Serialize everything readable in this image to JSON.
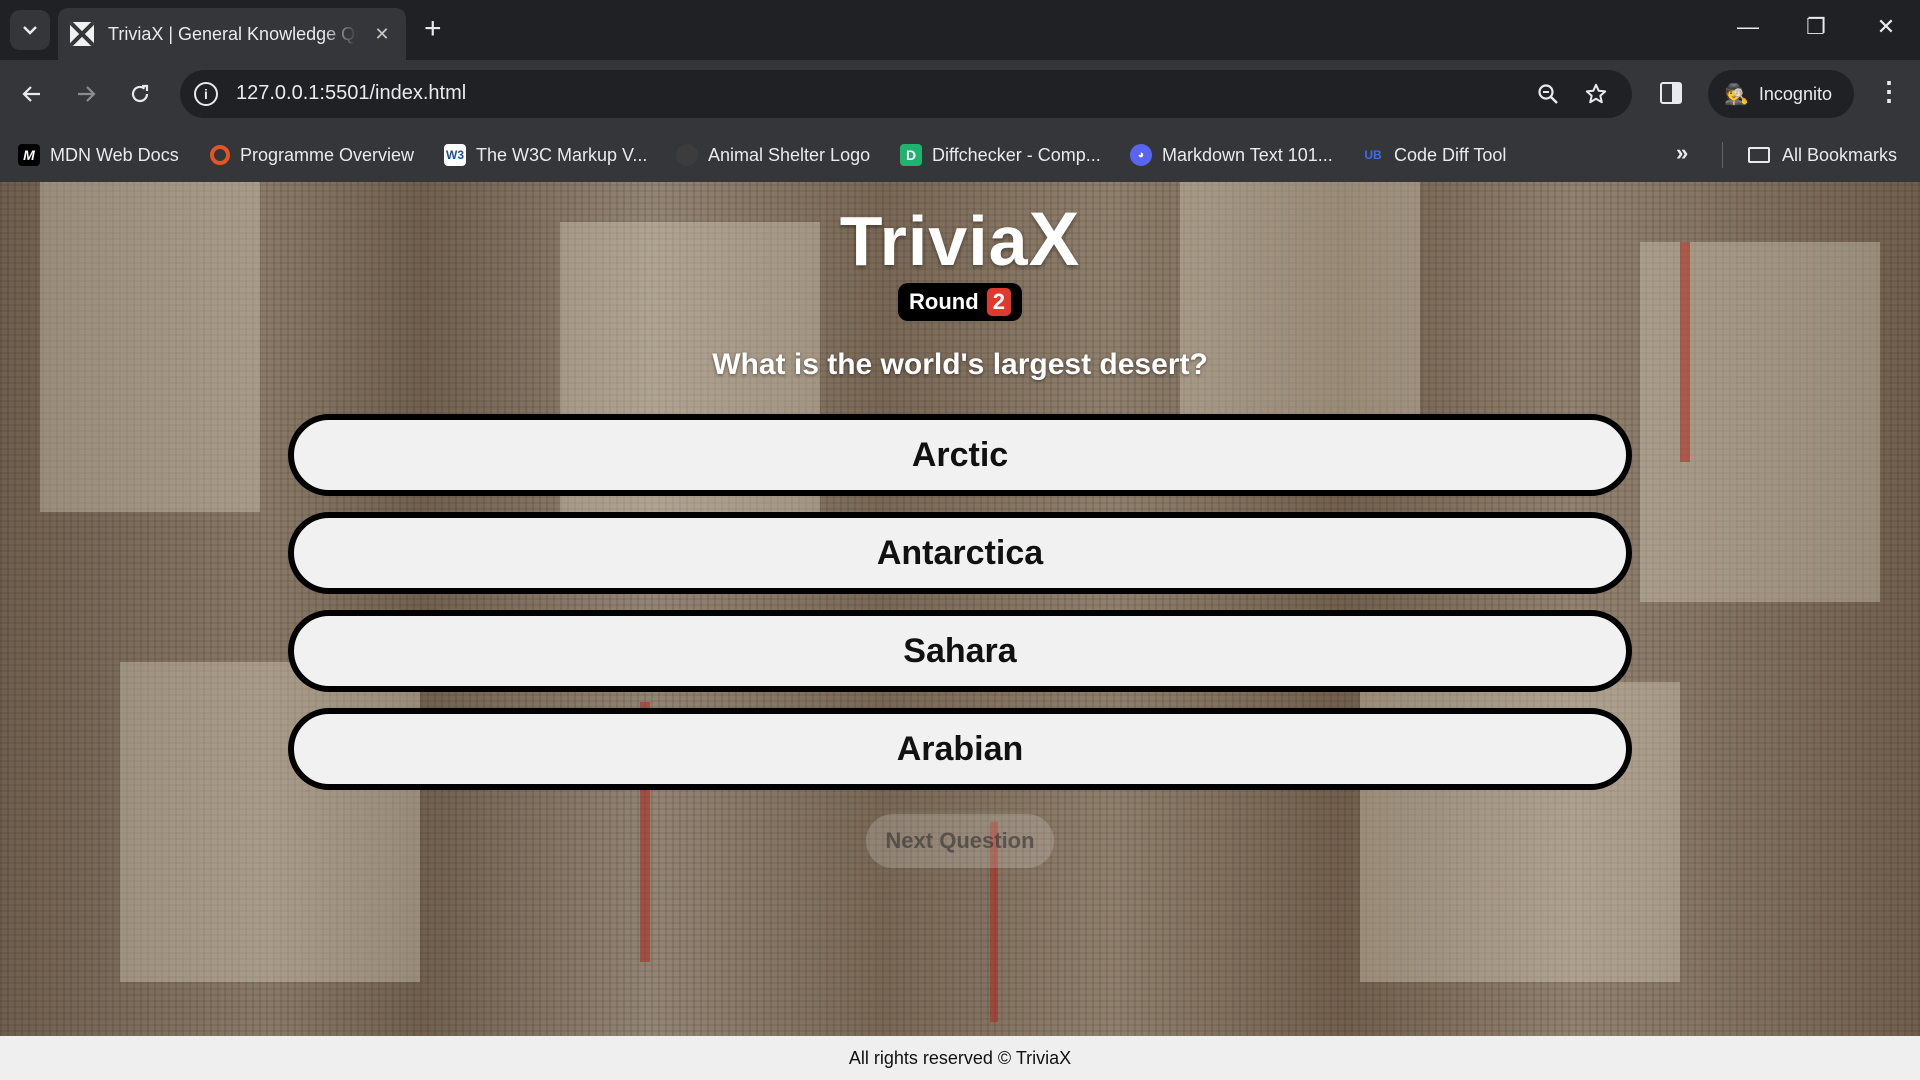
{
  "browser": {
    "tab_title": "TriviaX | General Knowledge Quiz",
    "new_tab_symbol": "+",
    "close_symbol": "✕",
    "url": "127.0.0.1:5501/index.html",
    "incognito_label": "Incognito",
    "window_controls": {
      "minimize": "—",
      "restore": "❐",
      "close": "✕"
    }
  },
  "bookmarks": {
    "items": [
      {
        "label": "MDN Web Docs",
        "icon": "mdn-icon",
        "icon_text": "M",
        "color": "#000000"
      },
      {
        "label": "Programme Overview",
        "icon": "ring-icon",
        "icon_text": "",
        "color": "#e8541f"
      },
      {
        "label": "The W3C Markup V...",
        "icon": "w3c-icon",
        "icon_text": "W3",
        "color": "#ffffff"
      },
      {
        "label": "Animal Shelter Logo",
        "icon": "github-icon",
        "icon_text": "",
        "color": "#3c3c3c"
      },
      {
        "label": "Diffchecker - Comp...",
        "icon": "diffchecker-icon",
        "icon_text": "D",
        "color": "#1fb46e"
      },
      {
        "label": "Markdown Text 101...",
        "icon": "discord-icon",
        "icon_text": "",
        "color": "#5865f2"
      },
      {
        "label": "Code Diff Tool",
        "icon": "code-diff-icon",
        "icon_text": "UB",
        "color": "#3b6ee8"
      }
    ],
    "all_bookmarks_label": "All Bookmarks"
  },
  "page": {
    "logo_text": "Trivia",
    "logo_x": "X",
    "round_label": "Round",
    "round_number": "2",
    "question": "What is the world's largest desert?",
    "answers": [
      "Arctic",
      "Antarctica",
      "Sahara",
      "Arabian"
    ],
    "next_label": "Next Question",
    "footer": "All rights reserved © TriviaX"
  },
  "colors": {
    "round_badge_accent": "#e03a2e",
    "answer_background": "#f1f1f1",
    "answer_border": "#000000"
  }
}
